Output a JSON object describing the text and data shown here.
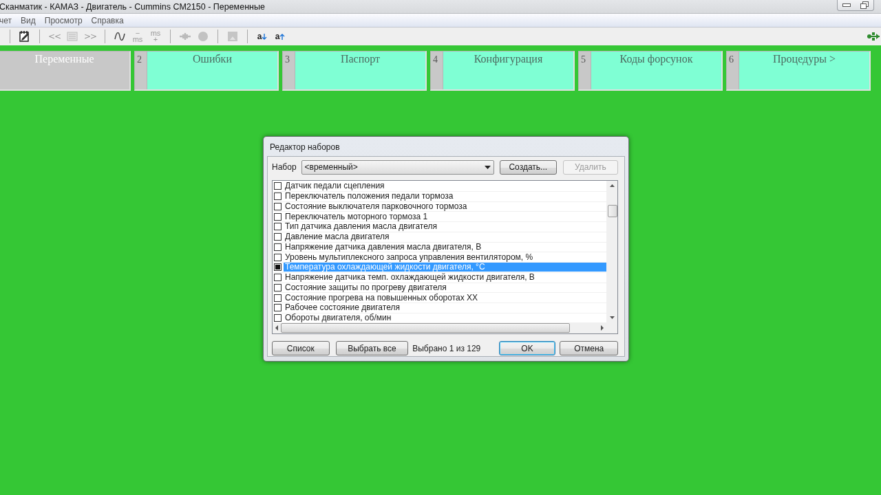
{
  "window": {
    "title": "Сканматик - КАМАЗ - Двигатель - Cummins CM2150 - Переменные"
  },
  "menu": [
    "чет",
    "Вид",
    "Просмотр",
    "Справка"
  ],
  "toolbar": [
    {
      "kind": "sep"
    },
    {
      "kind": "notes",
      "disabled": false
    },
    {
      "kind": "sep"
    },
    {
      "kind": "text",
      "label": "<<",
      "disabled": true
    },
    {
      "kind": "list",
      "disabled": true
    },
    {
      "kind": "text",
      "label": ">>",
      "disabled": true
    },
    {
      "kind": "sep"
    },
    {
      "kind": "wave",
      "disabled": false
    },
    {
      "kind": "stack",
      "top": "−",
      "bottom": "ms",
      "disabled": true
    },
    {
      "kind": "stack",
      "top": "ms",
      "bottom": "+",
      "disabled": true
    },
    {
      "kind": "sep"
    },
    {
      "kind": "probe",
      "disabled": true
    },
    {
      "kind": "record",
      "disabled": true
    },
    {
      "kind": "sep"
    },
    {
      "kind": "save",
      "disabled": true
    },
    {
      "kind": "sep"
    },
    {
      "kind": "descend",
      "label": "a",
      "disabled": false
    },
    {
      "kind": "ascend",
      "label": "a",
      "disabled": false
    }
  ],
  "tabs": [
    {
      "label": "Переменные",
      "selected": true
    },
    {
      "number": "2",
      "label": "Ошибки",
      "selected": false
    },
    {
      "number": "3",
      "label": "Паспорт",
      "selected": false
    },
    {
      "number": "4",
      "label": "Конфигурация",
      "selected": false
    },
    {
      "number": "5",
      "label": "Коды форсунок",
      "selected": false
    },
    {
      "number": "6",
      "label": "Процедуры >",
      "selected": false
    }
  ],
  "dialog": {
    "title": "Редактор наборов",
    "set_label": "Набор",
    "set_value": "<временный>",
    "buttons_top": [
      {
        "label": "Создать...",
        "disabled": false
      },
      {
        "label": "Удалить",
        "disabled": true
      }
    ],
    "items": [
      {
        "label": "Датчик педали сцепления",
        "checked": false,
        "selected": false
      },
      {
        "label": "Переключатель положения педали тормоза",
        "checked": false,
        "selected": false
      },
      {
        "label": "Состояние выключателя парковочного тормоза",
        "checked": false,
        "selected": false
      },
      {
        "label": "Переключатель моторного тормоза 1",
        "checked": false,
        "selected": false
      },
      {
        "label": "Тип датчика давления масла двигателя",
        "checked": false,
        "selected": false
      },
      {
        "label": "Давление масла двигателя",
        "checked": false,
        "selected": false
      },
      {
        "label": "Напряжение датчика давления масла двигателя, В",
        "checked": false,
        "selected": false
      },
      {
        "label": "Уровень мультиплексного запроса управления вентилятором, %",
        "checked": false,
        "selected": false
      },
      {
        "label": "Температура охлаждающей жидкости двигателя, °C",
        "checked": true,
        "selected": true
      },
      {
        "label": "Напряжение датчика темп. охлаждающей жидкости двигателя, В",
        "checked": false,
        "selected": false
      },
      {
        "label": "Состояние защиты по прогреву двигателя",
        "checked": false,
        "selected": false
      },
      {
        "label": "Состояние прогрева на повышенных оборотах XX",
        "checked": false,
        "selected": false
      },
      {
        "label": "Рабочее состояние двигателя",
        "checked": false,
        "selected": false
      },
      {
        "label": "Обороты двигателя, об/мин",
        "checked": false,
        "selected": false
      }
    ],
    "left_buttons": [
      "Список",
      "Выбрать все"
    ],
    "status": "Выбрано 1 из 129",
    "right_buttons": [
      {
        "label": "OK",
        "default": true
      },
      {
        "label": "Отмена",
        "default": false
      }
    ]
  }
}
